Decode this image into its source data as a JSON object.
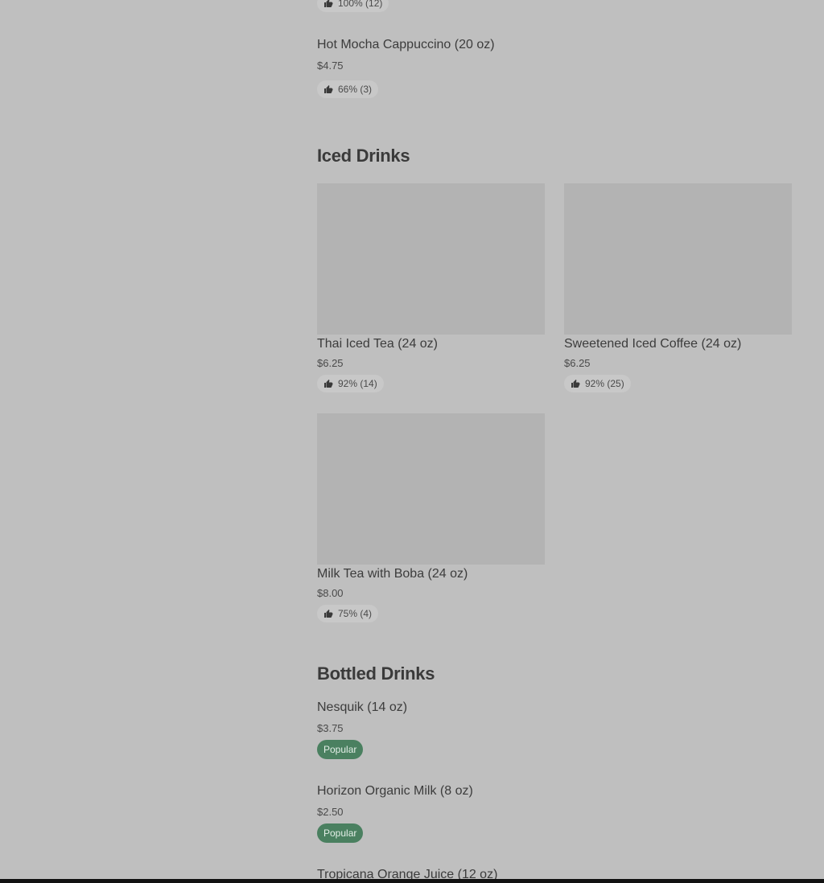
{
  "top_item": {
    "rating": "100% (12)"
  },
  "hot_mocha": {
    "name": "Hot Mocha Cappuccino (20 oz)",
    "price": "$4.75",
    "rating": "66% (3)"
  },
  "iced_drinks": {
    "title": "Iced Drinks",
    "items": [
      {
        "name": "Thai Iced Tea (24 oz)",
        "price": "$6.25",
        "rating": "92% (14)"
      },
      {
        "name": "Sweetened Iced Coffee (24 oz)",
        "price": "$6.25",
        "rating": "92% (25)"
      },
      {
        "name": "Milk Tea with Boba (24 oz)",
        "price": "$8.00",
        "rating": "75% (4)"
      }
    ]
  },
  "bottled_drinks": {
    "title": "Bottled Drinks",
    "items": [
      {
        "name": "Nesquik (14 oz)",
        "price": "$3.75",
        "badge": "Popular"
      },
      {
        "name": "Horizon Organic Milk (8 oz)",
        "price": "$2.50",
        "badge": "Popular"
      },
      {
        "name": "Tropicana Orange Juice (12 oz)"
      }
    ]
  },
  "icons": {
    "rating_icon": "thumbs-up-icon"
  },
  "colors": {
    "background": "#bfbfbf",
    "popular_badge": "#4a8060",
    "image_placeholder": "#b3b3b3"
  }
}
